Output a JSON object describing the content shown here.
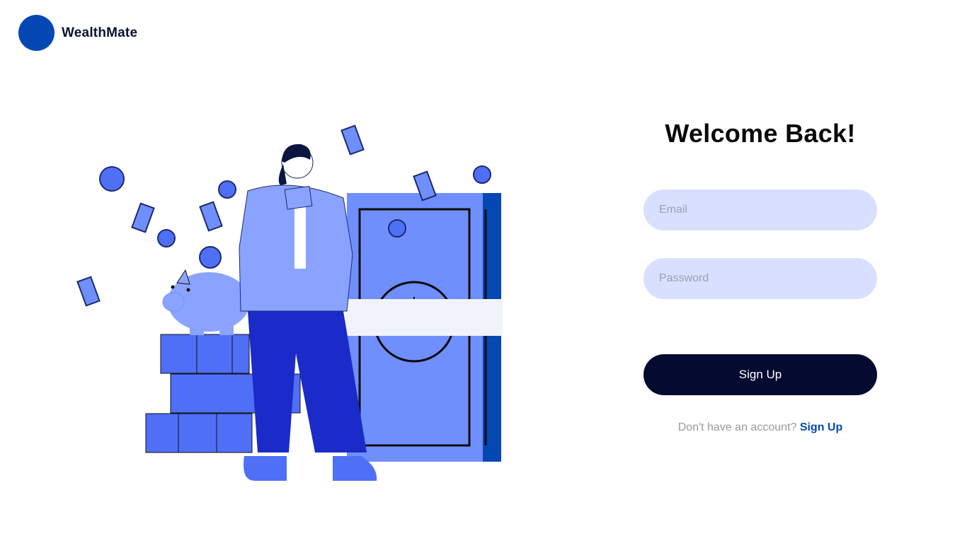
{
  "brand": {
    "name": "WealthMate"
  },
  "form": {
    "title": "Welcome Back!",
    "email_placeholder": "Email",
    "password_placeholder": "Password",
    "submit_label": "Sign Up",
    "footer_text": "Don't have an account?",
    "footer_link": "Sign Up"
  },
  "illustration": {
    "subject": "woman holding money beside piggy bank and safe"
  },
  "colors": {
    "brand_blue": "#0648b3",
    "input_bg": "#d9e0ff",
    "button_bg": "#050a30",
    "illustration_blue": "#6f8ffd"
  }
}
